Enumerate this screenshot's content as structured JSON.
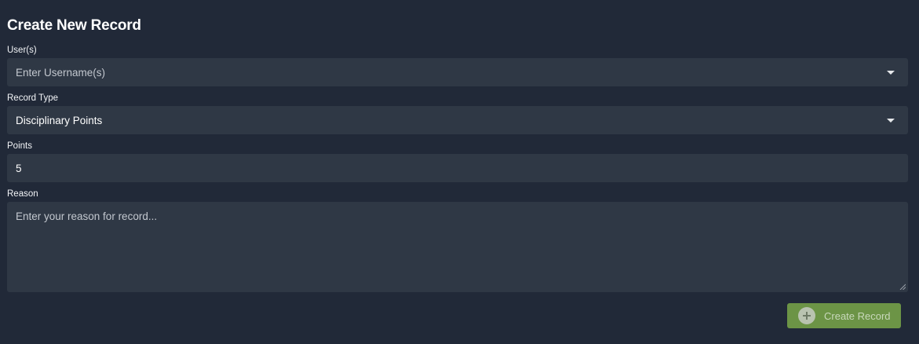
{
  "form": {
    "title": "Create New Record",
    "users": {
      "label": "User(s)",
      "placeholder": "Enter Username(s)"
    },
    "record_type": {
      "label": "Record Type",
      "value": "Disciplinary Points"
    },
    "points": {
      "label": "Points",
      "value": "5"
    },
    "reason": {
      "label": "Reason",
      "placeholder": "Enter your reason for record..."
    },
    "submit": {
      "label": "Create Record",
      "icon": "plus-circle-icon",
      "color": "#6c9446"
    }
  },
  "colors": {
    "background": "#212938",
    "field_background": "#2f3845"
  }
}
